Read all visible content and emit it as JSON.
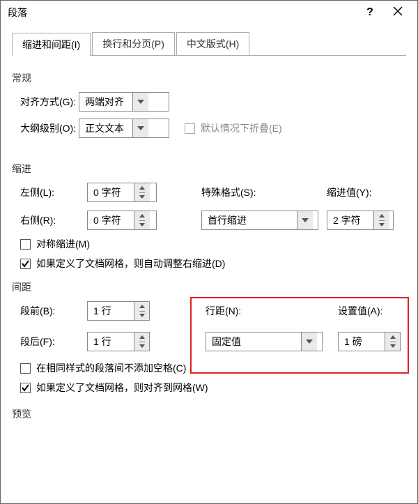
{
  "title": "段落",
  "tabs": {
    "indent_spacing": "缩进和间距(I)",
    "line_page": "换行和分页(P)",
    "cjk_layout": "中文版式(H)"
  },
  "sections": {
    "general": "常规",
    "indent": "缩进",
    "spacing": "间距",
    "preview": "预览"
  },
  "general_form": {
    "alignment_label": "对齐方式(G):",
    "alignment_value": "两端对齐",
    "outline_label": "大纲级别(O):",
    "outline_value": "正文文本",
    "collapse_label": "默认情况下折叠(E)"
  },
  "indent_form": {
    "left_label": "左侧(L):",
    "left_value": "0 字符",
    "right_label": "右侧(R):",
    "right_value": "0 字符",
    "special_label": "特殊格式(S):",
    "special_value": "首行缩进",
    "by_label": "缩进值(Y):",
    "by_value": "2 字符",
    "mirror_label": "对称缩进(M)",
    "autoadjust_label": "如果定义了文档网格，则自动调整右缩进(D)"
  },
  "spacing_form": {
    "before_label": "段前(B):",
    "before_value": "1 行",
    "after_label": "段后(F):",
    "after_value": "1 行",
    "line_spacing_label": "行距(N):",
    "line_spacing_value": "固定值",
    "at_label": "设置值(A):",
    "at_value": "1 磅",
    "no_space_same_style_label": "在相同样式的段落间不添加空格(C)",
    "snap_grid_label": "如果定义了文档网格，则对齐到网格(W)"
  }
}
